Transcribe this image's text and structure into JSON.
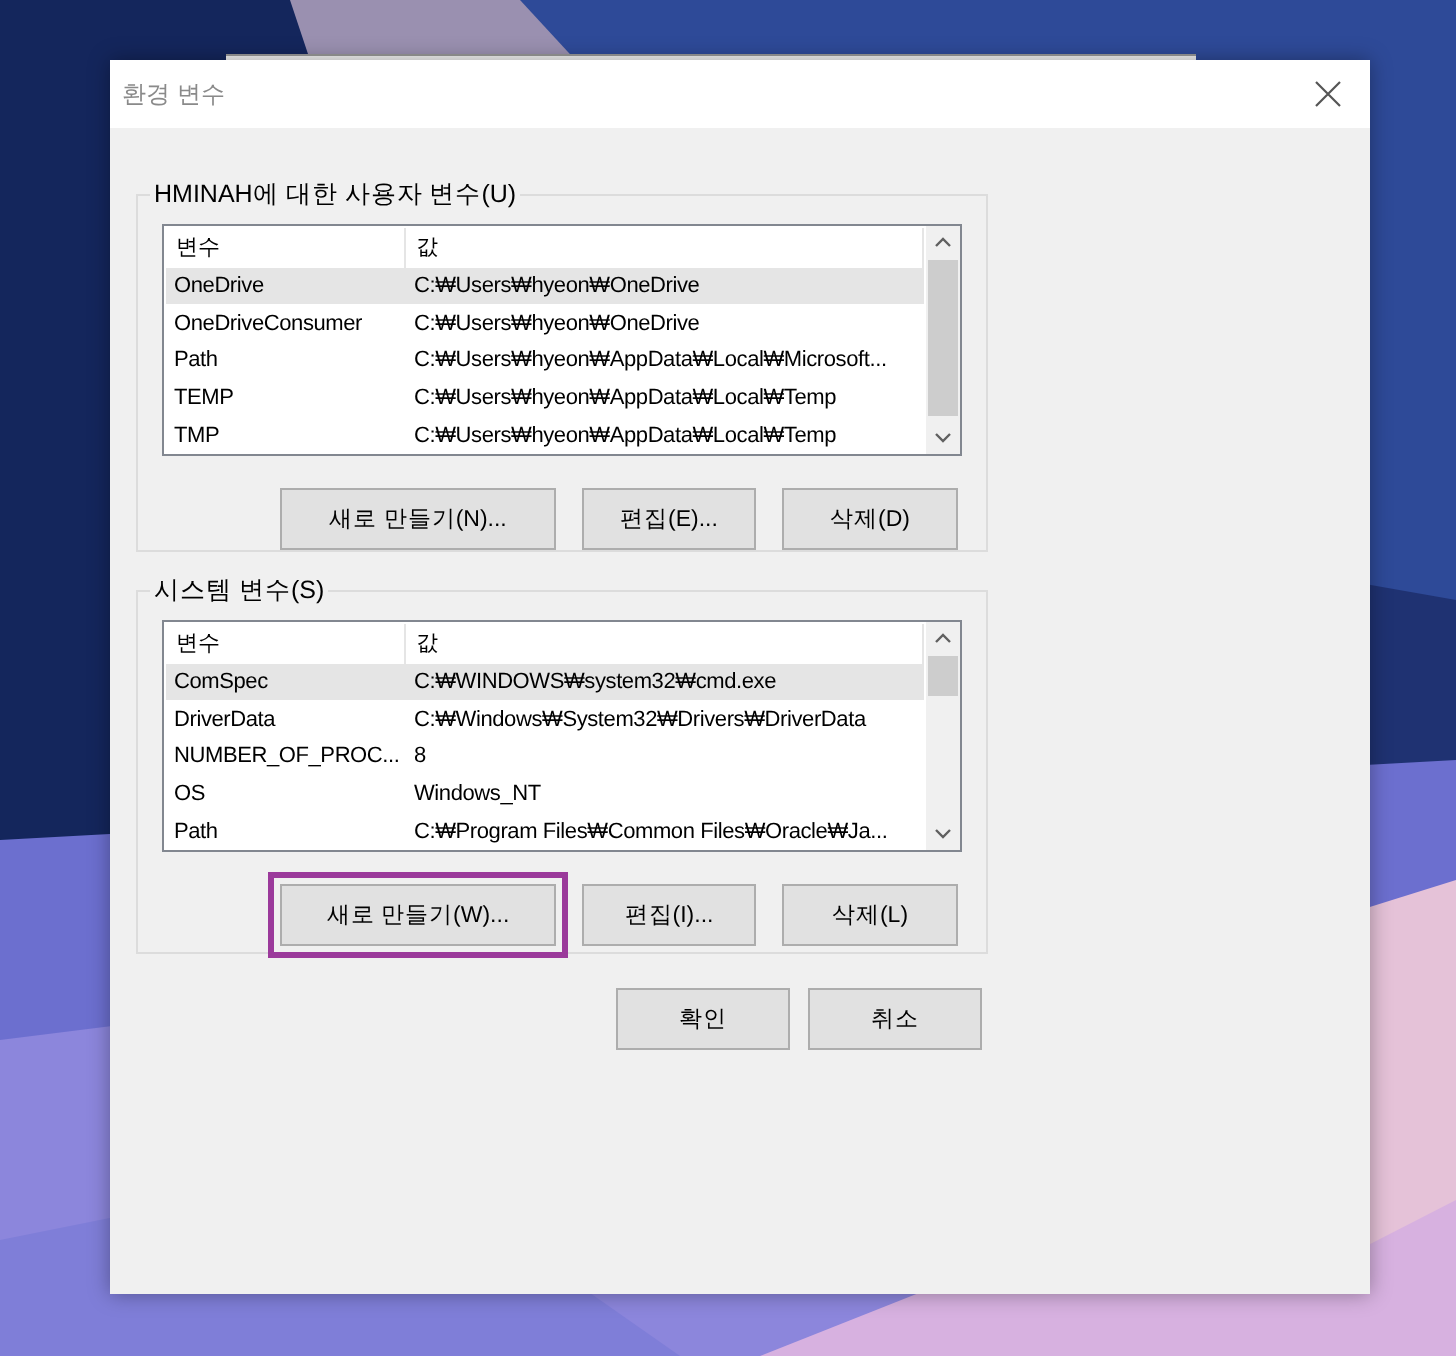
{
  "window": {
    "title": "환경 변수"
  },
  "user_variables": {
    "label": "HMINAH에 대한 사용자 변수(U)",
    "columns": [
      "변수",
      "값"
    ],
    "rows": [
      {
        "name": "OneDrive",
        "value": "C:₩Users₩hyeon₩OneDrive",
        "selected": true
      },
      {
        "name": "OneDriveConsumer",
        "value": "C:₩Users₩hyeon₩OneDrive",
        "selected": false
      },
      {
        "name": "Path",
        "value": "C:₩Users₩hyeon₩AppData₩Local₩Microsoft...",
        "selected": false
      },
      {
        "name": "TEMP",
        "value": "C:₩Users₩hyeon₩AppData₩Local₩Temp",
        "selected": false
      },
      {
        "name": "TMP",
        "value": "C:₩Users₩hyeon₩AppData₩Local₩Temp",
        "selected": false
      }
    ],
    "buttons": [
      {
        "label": "새로 만들기(N)...",
        "highlighted": false
      },
      {
        "label": "편집(E)...",
        "highlighted": false
      },
      {
        "label": "삭제(D)",
        "highlighted": false
      }
    ]
  },
  "system_variables": {
    "label": "시스템 변수(S)",
    "columns": [
      "변수",
      "값"
    ],
    "rows": [
      {
        "name": "ComSpec",
        "value": "C:₩WINDOWS₩system32₩cmd.exe",
        "selected": true
      },
      {
        "name": "DriverData",
        "value": "C:₩Windows₩System32₩Drivers₩DriverData",
        "selected": false
      },
      {
        "name": "NUMBER_OF_PROC...",
        "value": "8",
        "selected": false
      },
      {
        "name": "OS",
        "value": "Windows_NT",
        "selected": false
      },
      {
        "name": "Path",
        "value": "C:₩Program Files₩Common Files₩Oracle₩Ja...",
        "selected": false
      }
    ],
    "buttons": [
      {
        "label": "새로 만들기(W)...",
        "highlighted": true
      },
      {
        "label": "편집(I)...",
        "highlighted": false
      },
      {
        "label": "삭제(L)",
        "highlighted": false
      }
    ]
  },
  "dialog_buttons": [
    "확인",
    "취소"
  ]
}
